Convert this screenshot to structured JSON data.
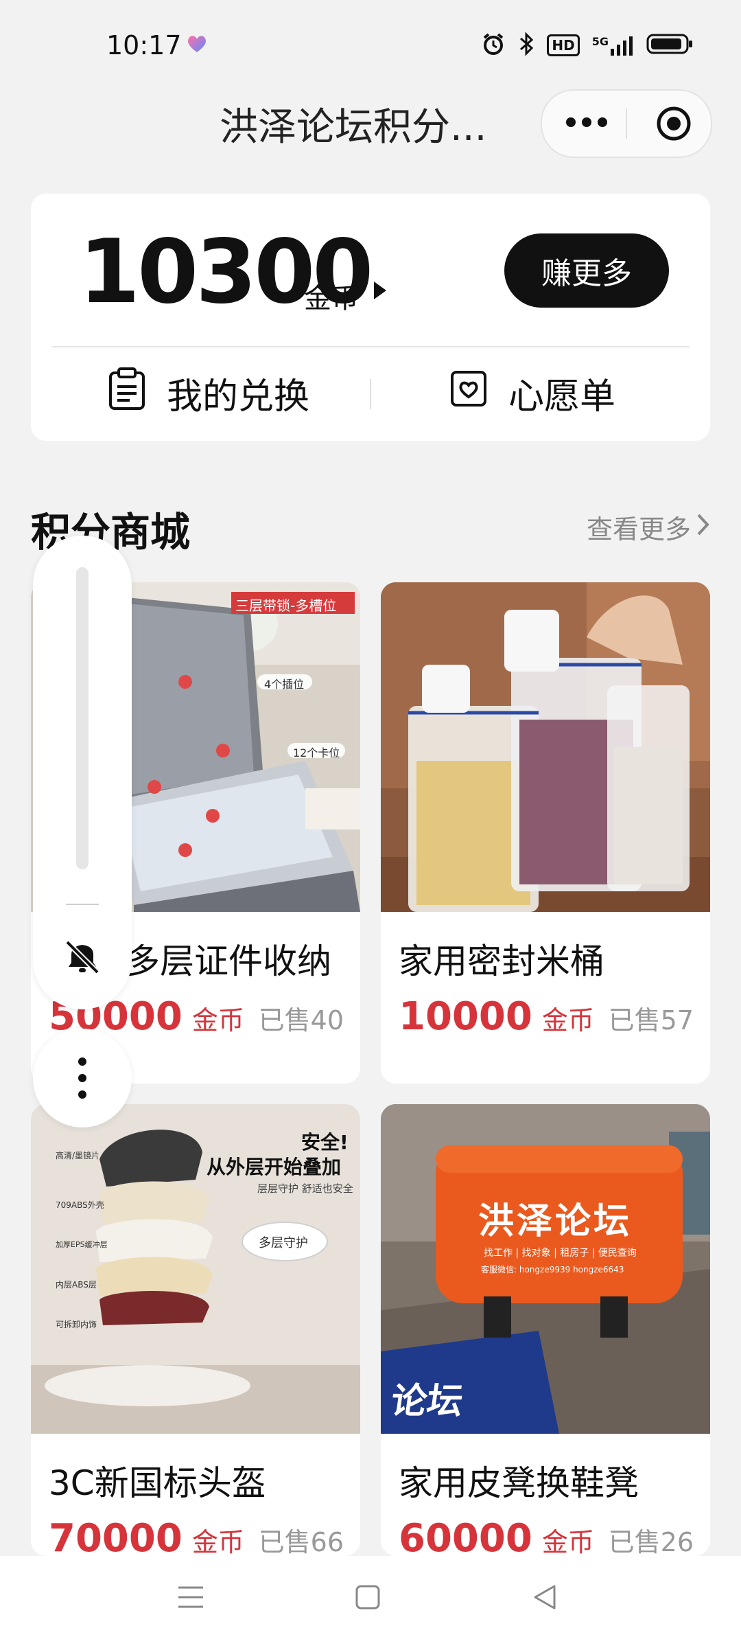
{
  "status_bar": {
    "time": "10:17",
    "hd_label": "HD",
    "network_label": "5G"
  },
  "navbar": {
    "title": "洪泽论坛积分..."
  },
  "coins": {
    "amount": "10300",
    "unit": "金币",
    "earn_button": "赚更多",
    "actions": {
      "exchange": "我的兑换",
      "wishlist": "心愿单"
    }
  },
  "mall": {
    "title": "积分商城",
    "see_more": "查看更多"
  },
  "products": [
    {
      "name": "多层证件收纳",
      "price": "50000",
      "unit": "金币",
      "sold": "已售40",
      "image_text": {
        "banner": "三层带锁-多槽位",
        "tag1": "4个插位",
        "tag2": "12个卡位"
      }
    },
    {
      "name": "家用密封米桶",
      "price": "10000",
      "unit": "金币",
      "sold": "已售57"
    },
    {
      "name": "3C新国标头盔",
      "price": "70000",
      "unit": "金币",
      "sold": "已售66",
      "image_text": {
        "headline1": "安全!",
        "headline2": "从外层开始叠加",
        "sub": "层层守护 舒适也安全",
        "bubble": "多层守护",
        "layers": [
          "高清/墨镜片",
          "709ABS外壳",
          "加厚EPS缓冲层",
          "内层ABS层",
          "可拆卸内饰"
        ]
      }
    },
    {
      "name": "家用皮凳换鞋凳",
      "price": "60000",
      "unit": "金币",
      "sold": "已售26",
      "image_text": {
        "brand": "洪泽论坛",
        "tagline": "找工作 | 找对象 | 租房子 | 便民查询",
        "contact": "客服微信: hongze9939 hongze6643",
        "mat": "论坛"
      }
    }
  ],
  "colors": {
    "accent": "#d6343a",
    "dark": "#111111",
    "background": "#f2f2f2"
  }
}
